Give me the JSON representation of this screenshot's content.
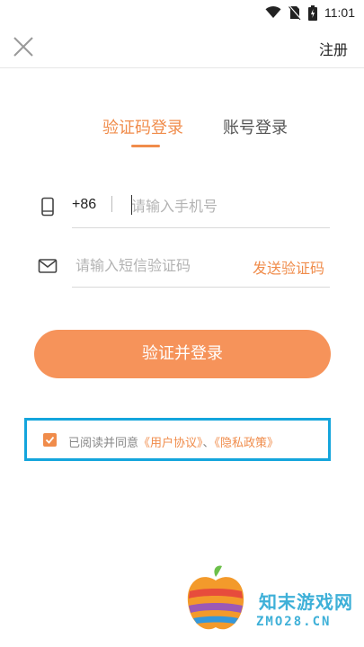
{
  "status_bar": {
    "time": "11:01"
  },
  "header": {
    "register_label": "注册"
  },
  "tabs": [
    {
      "label": "验证码登录",
      "active": true
    },
    {
      "label": "账号登录",
      "active": false
    }
  ],
  "phone_field": {
    "country_code": "+86",
    "placeholder": "请输入手机号",
    "value": ""
  },
  "code_field": {
    "placeholder": "请输入短信验证码",
    "value": "",
    "send_label": "发送验证码"
  },
  "login_button": {
    "label": "验证并登录"
  },
  "agreement": {
    "checked": true,
    "prefix": "已阅读并同意",
    "user_agreement": "《用户协议》",
    "separator": "、",
    "privacy_policy": "《隐私政策》"
  },
  "watermark": {
    "line1": "知末游戏网",
    "line2": "ZMO28.CN"
  },
  "colors": {
    "accent": "#f08c4b",
    "button": "#f6935a",
    "highlight_border": "#14a5dc"
  }
}
